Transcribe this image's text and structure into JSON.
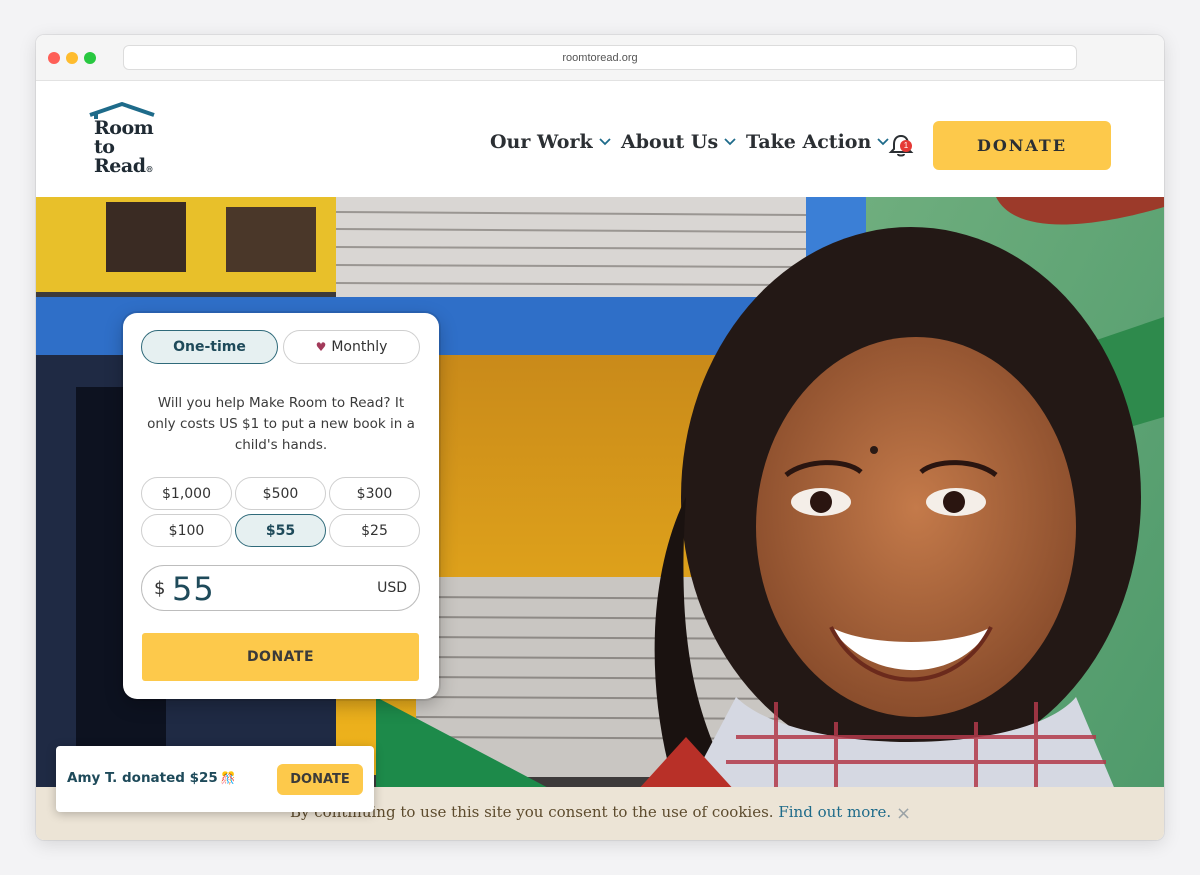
{
  "browser": {
    "url": "roomtoread.org"
  },
  "header": {
    "logo_lines": [
      "Room",
      "to",
      "Read"
    ],
    "logo_mark": "®",
    "nav": [
      {
        "label": "Our Work"
      },
      {
        "label": "About Us"
      },
      {
        "label": "Take Action"
      }
    ],
    "notification_count": "1",
    "donate_label": "DONATE"
  },
  "donation_form": {
    "frequency": {
      "one_time": "One-time",
      "monthly": "Monthly",
      "selected": "One-time"
    },
    "message": "Will you help Make Room to Read? It only costs US $1 to put a new book in a child's hands.",
    "amounts": [
      "$1,000",
      "$500",
      "$300",
      "$100",
      "$55",
      "$25"
    ],
    "selected_amount": "$55",
    "currency_symbol": "$",
    "amount_value": "55",
    "currency_code": "USD",
    "donate_label": "DONATE"
  },
  "cookie_banner": {
    "text": "By continuing to use this site you consent to the use of cookies.",
    "link": "Find out more.",
    "close": "×"
  },
  "toast": {
    "text": "Amy T. donated $25",
    "icon": "🎊",
    "button": "DONATE"
  },
  "colors": {
    "accent": "#fdc94b",
    "brand_teal": "#1e6b8a",
    "brand_dark": "#1f2a33"
  }
}
